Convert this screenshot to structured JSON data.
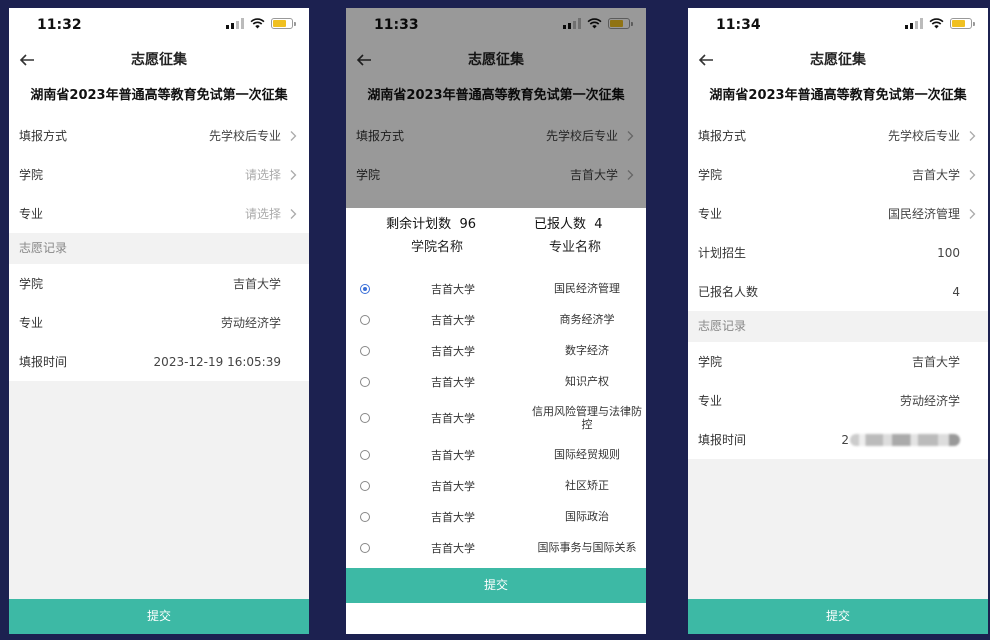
{
  "nav_title": "志愿征集",
  "heading": "湖南省2023年普通高等教育免试第一次征集",
  "submit_label": "提交",
  "section_records": "志愿记录",
  "phone1": {
    "time": "11:32",
    "rows": [
      {
        "label": "填报方式",
        "value": "先学校后专业"
      },
      {
        "label": "学院",
        "value": "请选择"
      },
      {
        "label": "专业",
        "value": "请选择"
      }
    ],
    "records": [
      {
        "label": "学院",
        "value": "吉首大学"
      },
      {
        "label": "专业",
        "value": "劳动经济学"
      },
      {
        "label": "填报时间",
        "value": "2023-12-19 16:05:39"
      }
    ]
  },
  "phone2": {
    "time": "11:33",
    "rows": [
      {
        "label": "填报方式",
        "value": "先学校后专业"
      },
      {
        "label": "学院",
        "value": "吉首大学"
      }
    ],
    "remaining_label": "剩余计划数",
    "remaining_value": "96",
    "registered_label": "已报人数",
    "registered_value": "4",
    "col_school": "学院名称",
    "col_major": "专业名称",
    "items": [
      {
        "school": "吉首大学",
        "major": "国民经济管理",
        "selected": true
      },
      {
        "school": "吉首大学",
        "major": "商务经济学",
        "selected": false
      },
      {
        "school": "吉首大学",
        "major": "数字经济",
        "selected": false
      },
      {
        "school": "吉首大学",
        "major": "知识产权",
        "selected": false
      },
      {
        "school": "吉首大学",
        "major": "信用风险管理与法律防控",
        "selected": false
      },
      {
        "school": "吉首大学",
        "major": "国际经贸规则",
        "selected": false
      },
      {
        "school": "吉首大学",
        "major": "社区矫正",
        "selected": false
      },
      {
        "school": "吉首大学",
        "major": "国际政治",
        "selected": false
      },
      {
        "school": "吉首大学",
        "major": "国际事务与国际关系",
        "selected": false
      }
    ]
  },
  "phone3": {
    "time": "11:34",
    "rows": [
      {
        "label": "填报方式",
        "value": "先学校后专业"
      },
      {
        "label": "学院",
        "value": "吉首大学"
      },
      {
        "label": "专业",
        "value": "国民经济管理"
      },
      {
        "label": "计划招生",
        "value": "100"
      },
      {
        "label": "已报名人数",
        "value": "4"
      }
    ],
    "records": [
      {
        "label": "学院",
        "value": "吉首大学"
      },
      {
        "label": "专业",
        "value": "劳动经济学"
      },
      {
        "label": "填报时间",
        "value": "2"
      }
    ]
  },
  "colors": {
    "accent": "#3db9a5",
    "radio_selected": "#3a6fd8",
    "battery": "#f0c020"
  },
  "icons": [
    "back-arrow-icon",
    "chevron-right-icon",
    "signal-icon",
    "wifi-icon",
    "battery-icon",
    "radio-icon"
  ]
}
